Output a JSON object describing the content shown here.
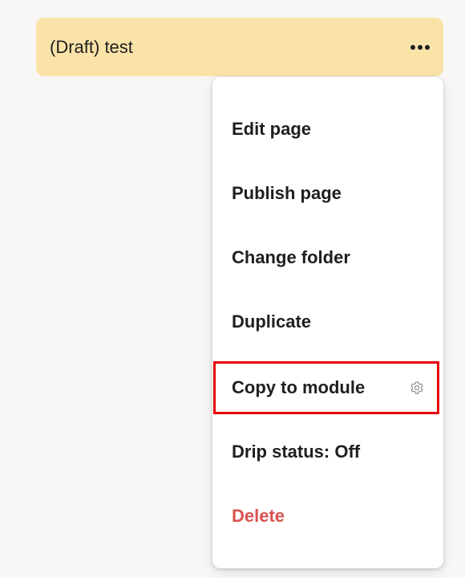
{
  "page": {
    "title": "(Draft) test",
    "more_button_icon": "more-horizontal-icon"
  },
  "menu": {
    "items": [
      {
        "label": "Edit page"
      },
      {
        "label": "Publish page"
      },
      {
        "label": "Change folder"
      },
      {
        "label": "Duplicate"
      },
      {
        "label": "Copy to module",
        "icon": "gear-icon",
        "highlighted": true
      },
      {
        "label": "Drip status: Off"
      },
      {
        "label": "Delete",
        "danger": true
      }
    ]
  },
  "colors": {
    "page_bar": "#fae3a8",
    "background": "#f8f7f5",
    "danger": "#d9534f",
    "highlight_box": "#e5000a"
  }
}
